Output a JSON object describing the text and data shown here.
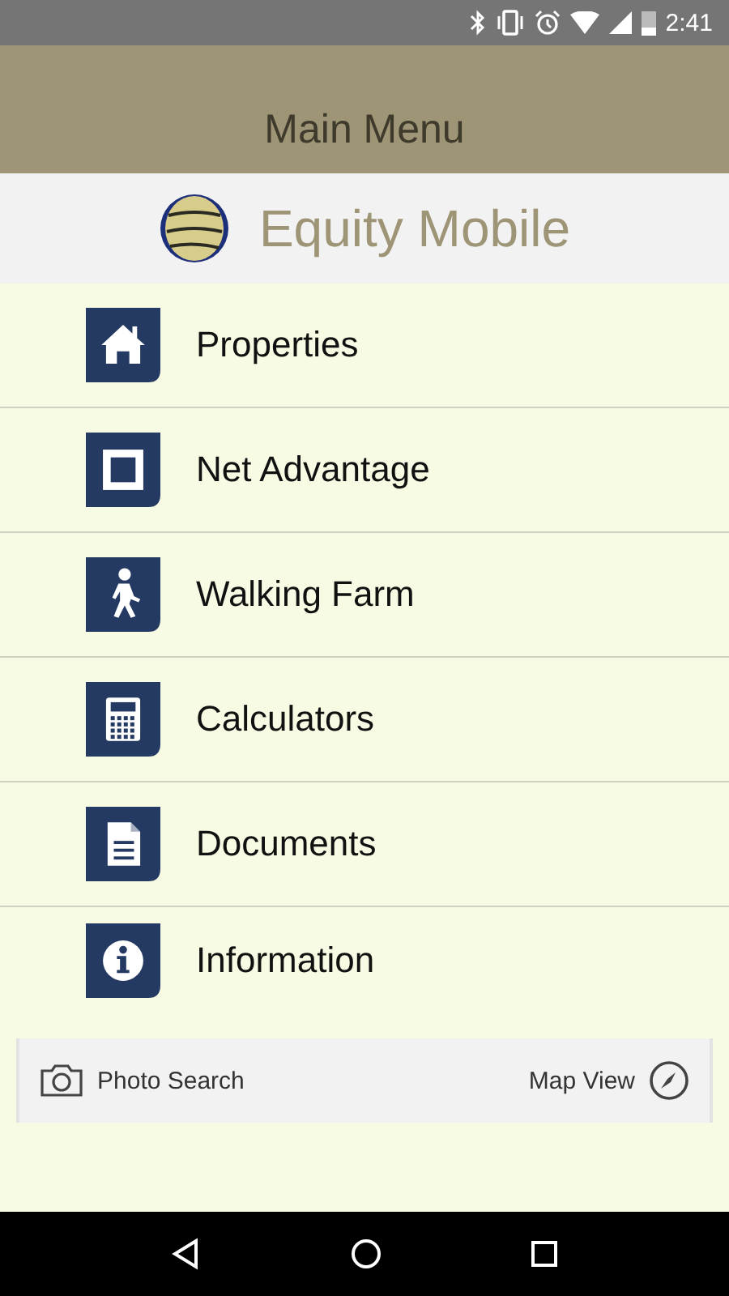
{
  "status_bar": {
    "time": "2:41"
  },
  "header": {
    "title": "Main Menu"
  },
  "brand": {
    "name": "Equity Mobile"
  },
  "menu": [
    {
      "label": "Properties",
      "kind": "house"
    },
    {
      "label": "Net Advantage",
      "kind": "square"
    },
    {
      "label": "Walking Farm",
      "kind": "walker"
    },
    {
      "label": "Calculators",
      "kind": "calculator"
    },
    {
      "label": "Documents",
      "kind": "document"
    },
    {
      "label": "Information",
      "kind": "info"
    }
  ],
  "bottom_bar": {
    "left": "Photo Search",
    "right": "Map View"
  }
}
